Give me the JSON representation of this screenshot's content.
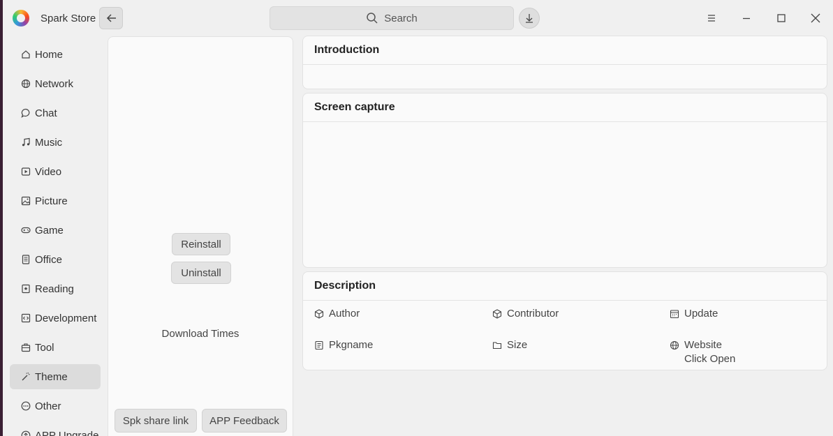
{
  "window": {
    "app_title": "Spark Store",
    "search_placeholder": "Search"
  },
  "sidebar": {
    "items": [
      {
        "label": "Home",
        "icon": "home-icon"
      },
      {
        "label": "Network",
        "icon": "globe-icon"
      },
      {
        "label": "Chat",
        "icon": "chat-icon"
      },
      {
        "label": "Music",
        "icon": "music-icon"
      },
      {
        "label": "Video",
        "icon": "video-icon"
      },
      {
        "label": "Picture",
        "icon": "image-icon"
      },
      {
        "label": "Game",
        "icon": "gamepad-icon"
      },
      {
        "label": "Office",
        "icon": "document-icon"
      },
      {
        "label": "Reading",
        "icon": "book-icon"
      },
      {
        "label": "Development",
        "icon": "code-icon"
      },
      {
        "label": "Tool",
        "icon": "toolbox-icon"
      },
      {
        "label": "Theme",
        "icon": "magic-wand-icon"
      },
      {
        "label": "Other",
        "icon": "ellipsis-icon"
      },
      {
        "label": "APP Upgrade",
        "icon": "upgrade-icon"
      }
    ],
    "active": "Theme"
  },
  "app_panel": {
    "reinstall_label": "Reinstall",
    "uninstall_label": "Uninstall",
    "download_times_label": "Download Times",
    "share_label": "Spk share link",
    "feedback_label": "APP Feedback"
  },
  "main": {
    "introduction_title": "Introduction",
    "screen_capture_title": "Screen capture",
    "description_title": "Description",
    "fields": {
      "author": "Author",
      "contributor": "Contributor",
      "update": "Update",
      "pkgname": "Pkgname",
      "size": "Size",
      "website": "Website",
      "website_link": "Click Open"
    }
  },
  "colors": {
    "window_bg": "#f0f0f0",
    "card_bg": "#fafafa",
    "active_item_bg": "#dcdcdc",
    "desktop_bg": "#3a1f33"
  }
}
